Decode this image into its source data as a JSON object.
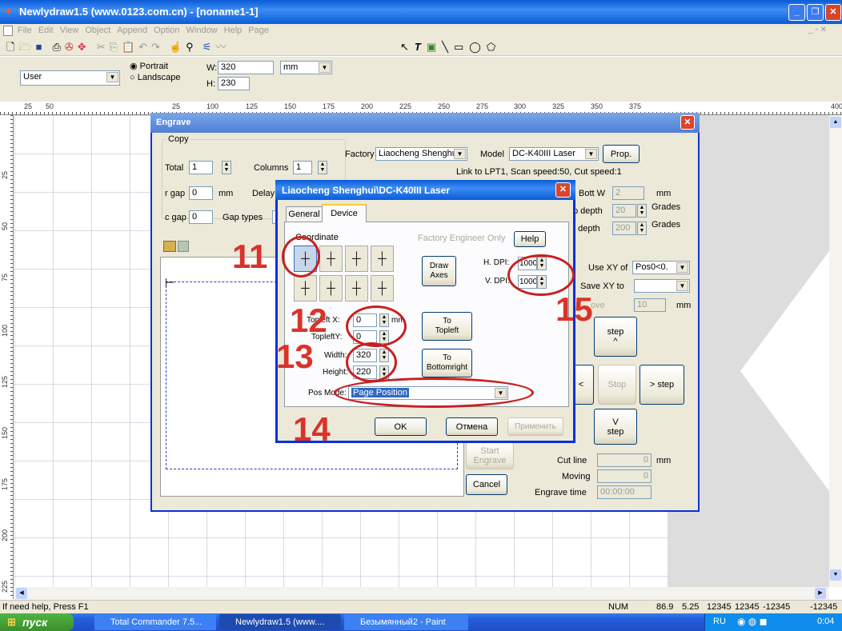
{
  "app": {
    "title": "Newlydraw1.5 (www.0123.com.cn) - [noname1-1]",
    "menu": [
      "File",
      "Edit",
      "View",
      "Object",
      "Append",
      "Option",
      "Window",
      "Help",
      "Page"
    ],
    "page_size_select": "User",
    "orientation_portrait": "Portrait",
    "orientation_landscape": "Landscape",
    "w_label": "W:",
    "w_value": "320",
    "h_label": "H:",
    "h_value": "230",
    "unit_select": "mm",
    "ruler_h_ticks": [
      "25",
      "50",
      "25",
      "100",
      "125",
      "150",
      "175",
      "200",
      "225",
      "250",
      "275",
      "300",
      "325",
      "350",
      "375",
      "400"
    ],
    "ruler_v_ticks": [
      "25",
      "50",
      "75",
      "100",
      "125",
      "150",
      "175",
      "200",
      "225"
    ],
    "status_text": "If need help, Press F1",
    "status_num": "NUM",
    "status_values": [
      "86.9",
      "5.25",
      "12345",
      "12345",
      "-12345",
      "-12345"
    ]
  },
  "engrave": {
    "title": "Engrave",
    "copy_group": "Copy",
    "total_label": "Total",
    "total_value": "1",
    "columns_label": "Columns",
    "columns_value": "1",
    "rgap_label": "r gap",
    "rgap_value": "0",
    "rgap_unit": "mm",
    "delay_label": "Delay",
    "cgap_label": "c gap",
    "cgap_value": "0",
    "gap_types_label": "Gap types",
    "factory_label": "Factory",
    "factory_value": "Liaocheng Shenghui",
    "model_label": "Model",
    "model_value": "DC-K40III Laser",
    "prop_button": "Prop.",
    "link_info": "Link to LPT1, Scan speed:50, Cut speed:1",
    "bott_w_label": "Bott W",
    "bott_w_value": "2",
    "bott_w_unit": "mm",
    "p_depth_label": "p depth",
    "p_depth_value": "20",
    "p_depth_unit": "Grades",
    "t_depth_label": "t depth",
    "t_depth_value": "200",
    "t_depth_unit": "Grades",
    "use_xy_label": "Use XY of",
    "use_xy_value": "Pos0<0.",
    "save_xy_label": "Save XY to",
    "save_xy_value": "",
    "move_label": "ove",
    "move_value": "10",
    "move_unit": "mm",
    "step_up": "step\n^",
    "step_left": "<",
    "stop": "Stop",
    "step_right": "> step",
    "step_down": "V\nstep",
    "start_engrave": "Start\nEngrave",
    "cancel": "Cancel",
    "cut_line_label": "Cut line",
    "cut_line_value": "0",
    "cut_line_unit": "mm",
    "moving_label": "Moving",
    "moving_value": "0",
    "engrave_time_label": "Engrave time",
    "engrave_time_value": "00:00:00"
  },
  "device": {
    "title": "Liaocheng Shenghui\\DC-K40III Laser",
    "tab_general": "General",
    "tab_device": "Device",
    "coordinate_label": "Coordinate",
    "factory_engineer_only": "Factory Engineer Only",
    "help_button": "Help",
    "draw_axes": "Draw\nAxes",
    "h_dpi_label": "H. DPI:",
    "h_dpi_value": "1000",
    "v_dpi_label": "V. DPI:",
    "v_dpi_value": "1000",
    "topleft_x_label": "Topleft X:",
    "topleft_x_value": "0",
    "topleft_unit": "mm",
    "topleft_y_label": "TopleftY:",
    "topleft_y_value": "0",
    "to_topleft": "To\nTopleft",
    "width_label": "Width:",
    "width_value": "320",
    "height_label": "Height:",
    "height_value": "220",
    "to_bottomright": "To\nBottomright",
    "pos_mode_label": "Pos Mode:",
    "pos_mode_value": "Page Position",
    "ok": "OK",
    "cancel": "Отмена",
    "apply": "Применить"
  },
  "annotations": [
    "11",
    "12",
    "13",
    "14",
    "15"
  ],
  "taskbar": {
    "start": "пуск",
    "tasks": [
      "Total Commander 7.5...",
      "Newlydraw1.5 (www....",
      "Безымянный2 - Paint"
    ],
    "lang": "RU",
    "clock": "0:04"
  },
  "colors": {
    "xp_blue": "#0a5bd8",
    "taskbar_blue": "#245edb",
    "start_green": "#3c8f2c",
    "annotation_red": "#d9332a",
    "dialog_face": "#ece9d8"
  }
}
